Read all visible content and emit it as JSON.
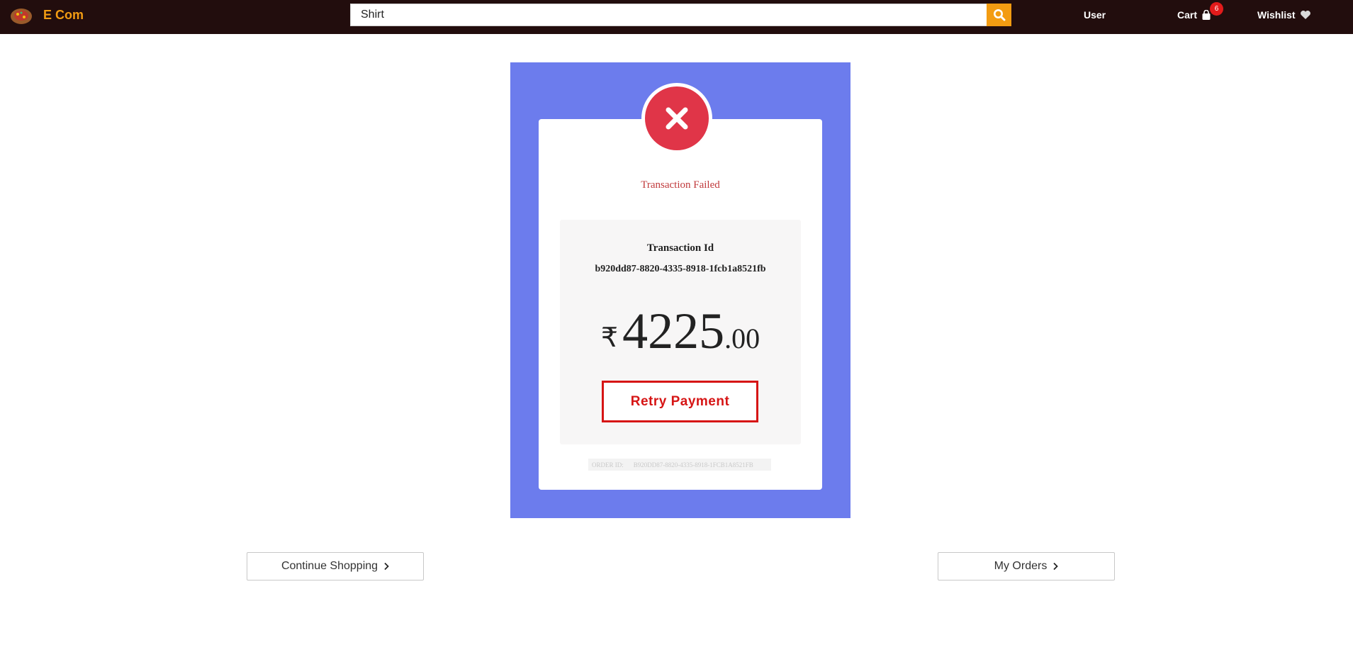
{
  "navbar": {
    "brand": "E Com",
    "search_value": "Shirt",
    "user_label": "User",
    "cart_label": "Cart",
    "cart_count": "6",
    "wishlist_label": "Wishlist"
  },
  "colors": {
    "navbar_bg": "#220d0d",
    "accent": "#f39c12",
    "panel_blue": "#6c7ced",
    "fail_red": "#e03548",
    "retry_red": "#d61515"
  },
  "icons": {
    "logo": "ecom-logo-icon",
    "search": "search-icon",
    "cart": "shopping-bag-icon",
    "wishlist": "heart-icon",
    "fail": "close-icon",
    "chevron": "chevron-right-icon"
  },
  "transaction": {
    "status": "Transaction Failed",
    "id_label": "Transaction Id",
    "id_value": "b920dd87-8820-4335-8918-1fcb1a8521fb",
    "currency": "₹",
    "amount_int": "4225",
    "amount_dec": ".00",
    "retry_label": "Retry Payment",
    "order_label": "ORDER ID:",
    "order_value": "B920DD87-8820-4335-8918-1FCB1A8521FB"
  },
  "actions": {
    "continue_label": "Continue Shopping",
    "orders_label": "My Orders"
  }
}
